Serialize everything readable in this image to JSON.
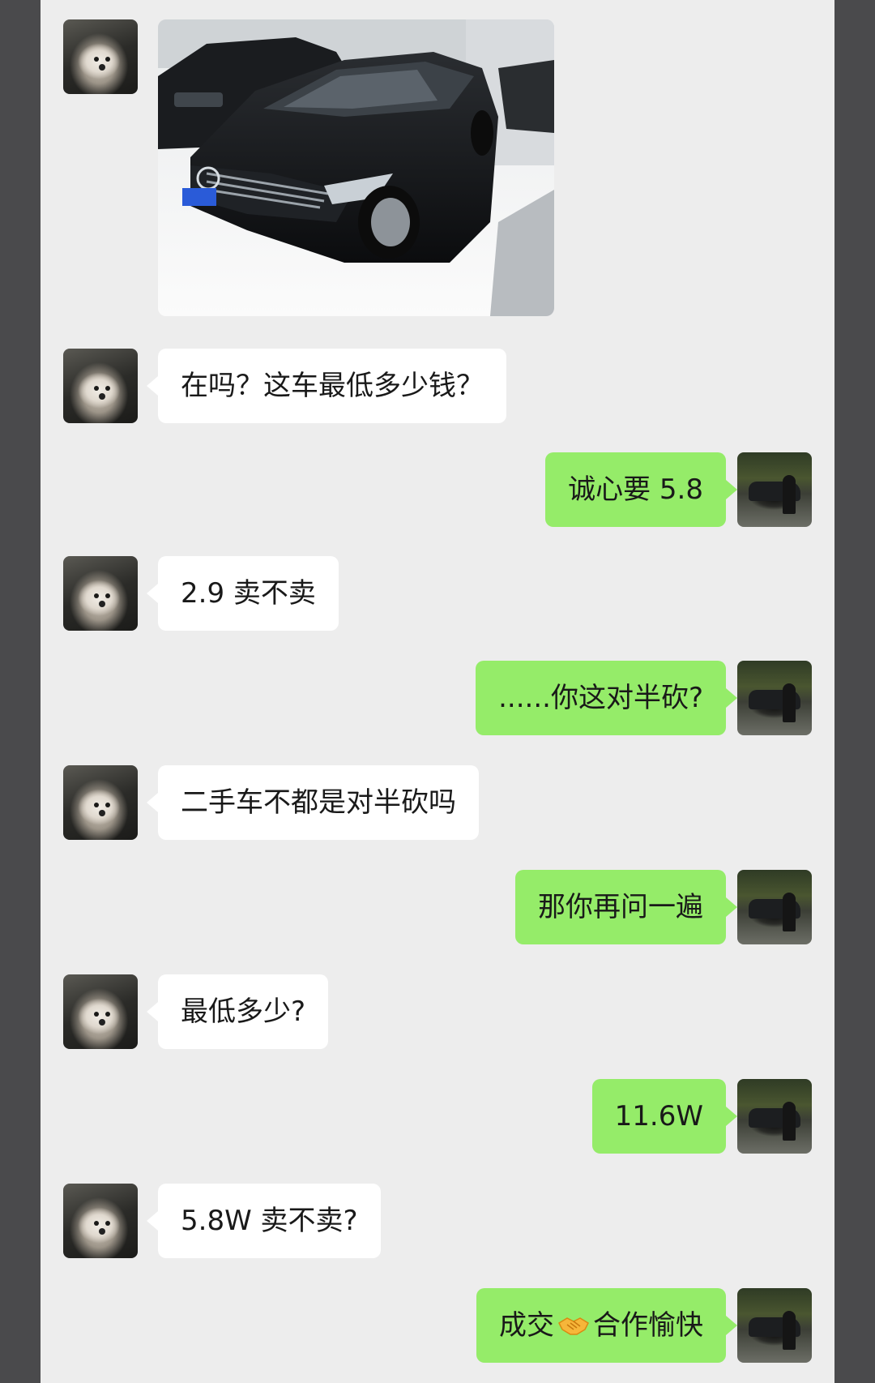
{
  "messages": [
    {
      "side": "in",
      "type": "image",
      "alt": "black sedan in showroom"
    },
    {
      "side": "in",
      "text": "在吗？这车最低多少钱？"
    },
    {
      "side": "out",
      "text": "诚心要 5.8"
    },
    {
      "side": "in",
      "text": "2.9 卖不卖"
    },
    {
      "side": "out",
      "text": "......你这对半砍?"
    },
    {
      "side": "in",
      "text": "二手车不都是对半砍吗"
    },
    {
      "side": "out",
      "text": "那你再问一遍"
    },
    {
      "side": "in",
      "text": "最低多少?"
    },
    {
      "side": "out",
      "text": "11.6W"
    },
    {
      "side": "in",
      "text": "5.8W 卖不卖?"
    },
    {
      "side": "out",
      "text_before": "成交",
      "emoji": "handshake",
      "text_after": "合作愉快"
    }
  ],
  "colors": {
    "chat_bg": "#ededed",
    "incoming_bubble": "#ffffff",
    "outgoing_bubble": "#95ec69",
    "text": "#191919"
  }
}
